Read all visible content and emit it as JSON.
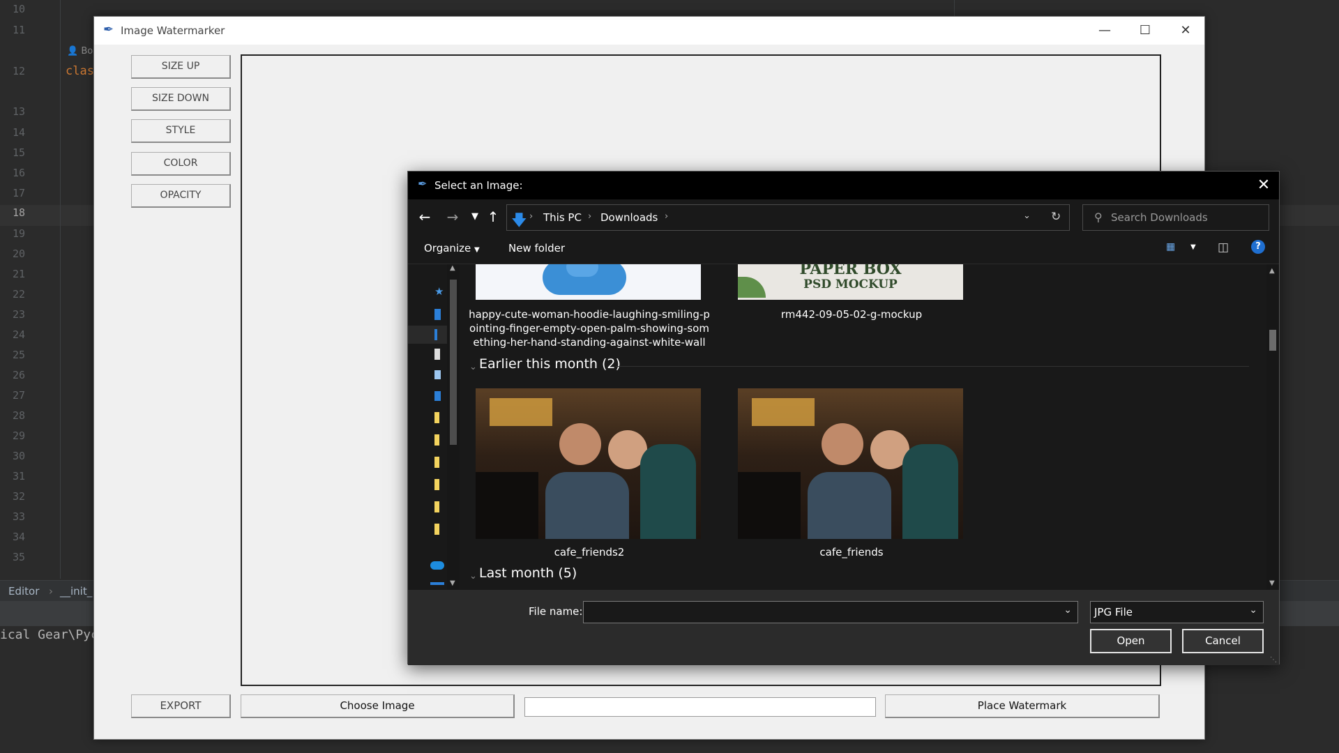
{
  "ide": {
    "line_numbers": [
      "10",
      "11",
      "12",
      "13",
      "14",
      "15",
      "16",
      "17",
      "18",
      "19",
      "20",
      "21",
      "22",
      "23",
      "24",
      "25",
      "26",
      "27",
      "28",
      "29",
      "30",
      "31",
      "32",
      "33",
      "34",
      "35"
    ],
    "active_line": "18",
    "code_fragment": "clas",
    "author_fragment": "Bo",
    "breadcrumb": [
      "Editor",
      "__init_"
    ],
    "terminal_text": "ical Gear\\Pyc"
  },
  "watermarker": {
    "title": "Image Watermarker",
    "side_buttons": [
      "SIZE UP",
      "SIZE DOWN",
      "STYLE",
      "COLOR",
      "OPACITY"
    ],
    "export_label": "EXPORT",
    "choose_image_label": "Choose Image",
    "watermark_text_value": "",
    "place_watermark_label": "Place Watermark"
  },
  "dialog": {
    "title": "Select an Image:",
    "breadcrumb": [
      "This PC",
      "Downloads"
    ],
    "search_placeholder": "Search Downloads",
    "organize_label": "Organize",
    "new_folder_label": "New folder",
    "groups": [
      {
        "name": "Earlier this month (2)"
      },
      {
        "name": "Last month (5)"
      }
    ],
    "files_top": [
      {
        "name": "happy-cute-woman-hoodie-laughing-smiling-pointing-finger-empty-open-palm-showing-something-her-hand-standing-against-white-wall",
        "lines": [
          "happy-cute-woman-hoodie-laughing-smiling-p",
          "ointing-finger-empty-open-palm-showing-som",
          "ething-her-hand-standing-against-white-wall"
        ]
      },
      {
        "name": "rm442-09-05-02-g-mockup",
        "lines": [
          "rm442-09-05-02-g-mockup"
        ],
        "thumb_text": [
          "PAPER BOX",
          "PSD MOCKUP"
        ]
      }
    ],
    "files_earlier": [
      {
        "name": "cafe_friends2"
      },
      {
        "name": "cafe_friends"
      }
    ],
    "file_name_label": "File name:",
    "file_name_value": "",
    "file_type": "JPG File",
    "open_label": "Open",
    "cancel_label": "Cancel"
  }
}
